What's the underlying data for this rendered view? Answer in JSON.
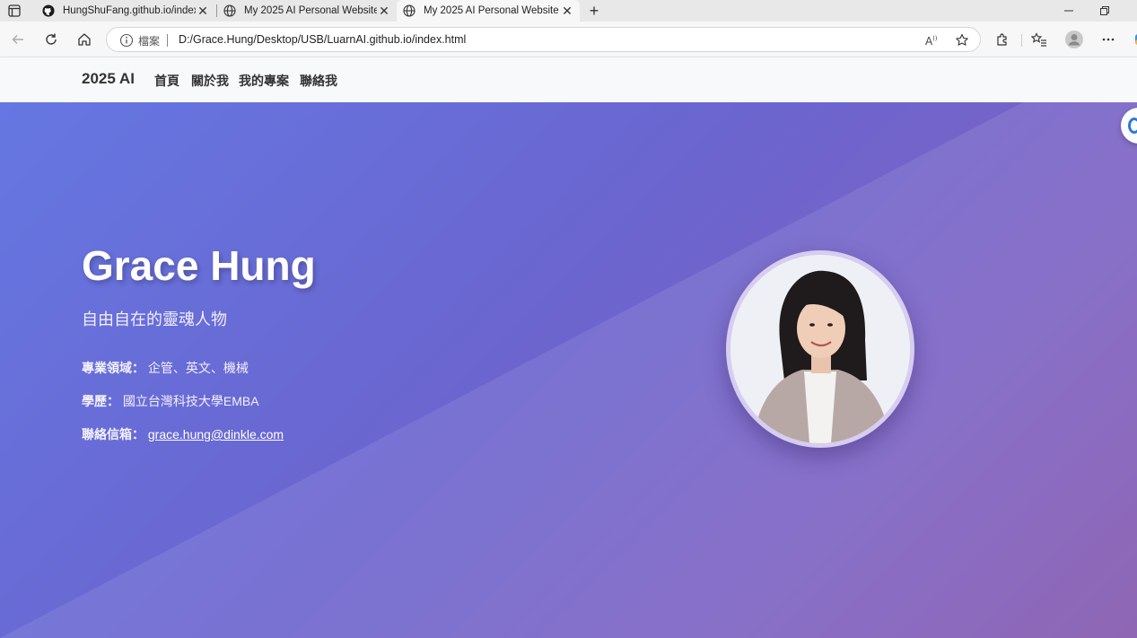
{
  "browser": {
    "tabs": [
      {
        "title": "HungShuFang.github.io/index.htm",
        "icon": "github-icon",
        "active": false
      },
      {
        "title": "My 2025 AI Personal Website",
        "icon": "globe-icon",
        "active": false
      },
      {
        "title": "My 2025 AI Personal Website",
        "icon": "globe-icon",
        "active": true
      }
    ],
    "address_label": "檔案",
    "url": "D:/Grace.Hung/Desktop/USB/LuarnAI.github.io/index.html"
  },
  "site": {
    "brand": "2025 AI",
    "nav": [
      "首頁",
      "關於我",
      "我的專案",
      "聯絡我"
    ]
  },
  "hero": {
    "name": "Grace Hung",
    "tagline": "自由自在的靈魂人物",
    "fields_label": "專業領域：",
    "fields_value": "企管、英文、機械",
    "education_label": "學歷：",
    "education_value": "國立台灣科技大學EMBA",
    "email_label": "聯絡信箱：",
    "email_value": "grace.hung@dinkle.com"
  },
  "colors": {
    "hero_start": "#6577e2",
    "hero_end": "#8457ad",
    "nav_bg": "#f8f9fa"
  }
}
